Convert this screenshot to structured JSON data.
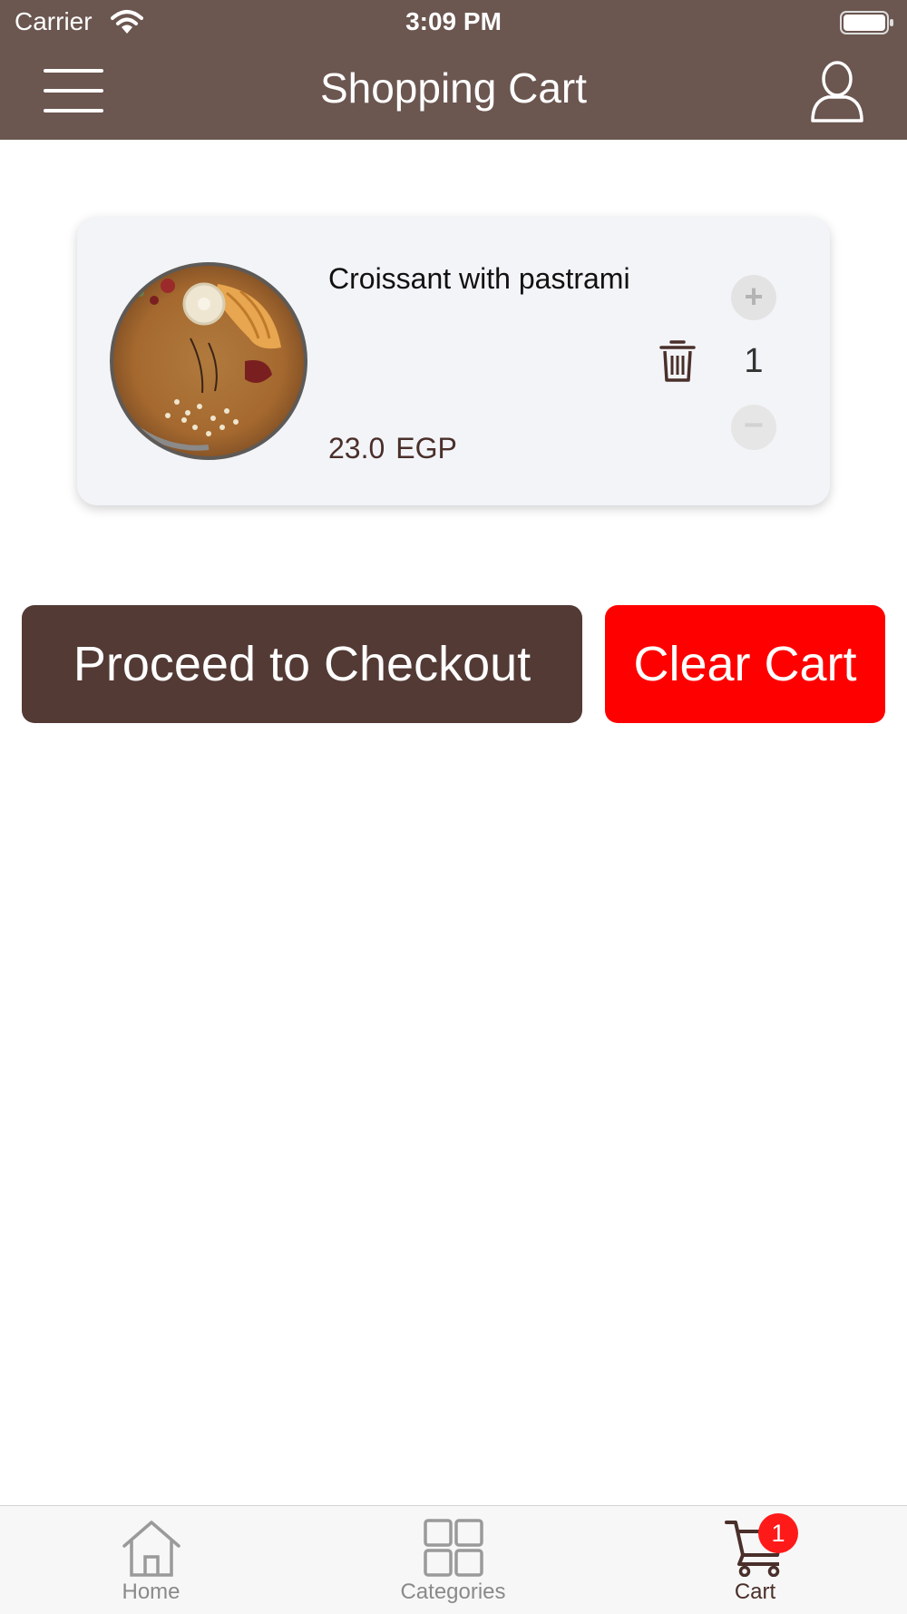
{
  "status_bar": {
    "carrier": "Carrier",
    "time": "3:09 PM"
  },
  "header": {
    "title": "Shopping Cart",
    "menu_icon": "hamburger-menu-icon",
    "profile_icon": "user-profile-icon",
    "background_color": "#6b5650"
  },
  "cart": {
    "items": [
      {
        "name": "Croissant with pastrami",
        "price": "23.0",
        "currency": "EGP",
        "quantity": "1",
        "plus_label": "+",
        "minus_label": "−",
        "image_icon": "croissant-photo",
        "delete_icon": "trash-icon"
      }
    ]
  },
  "actions": {
    "checkout_label": "Proceed to Checkout",
    "checkout_color": "#533a35",
    "clear_label": "Clear Cart",
    "clear_color": "#ff0000"
  },
  "tab_bar": {
    "tabs": [
      {
        "label": "Home",
        "icon": "home-icon",
        "active": false
      },
      {
        "label": "Categories",
        "icon": "grid-icon",
        "active": false
      },
      {
        "label": "Cart",
        "icon": "cart-icon",
        "active": true
      }
    ],
    "cart_badge": "1",
    "active_color": "#4a2f2a",
    "inactive_color": "#8a8a8a"
  }
}
